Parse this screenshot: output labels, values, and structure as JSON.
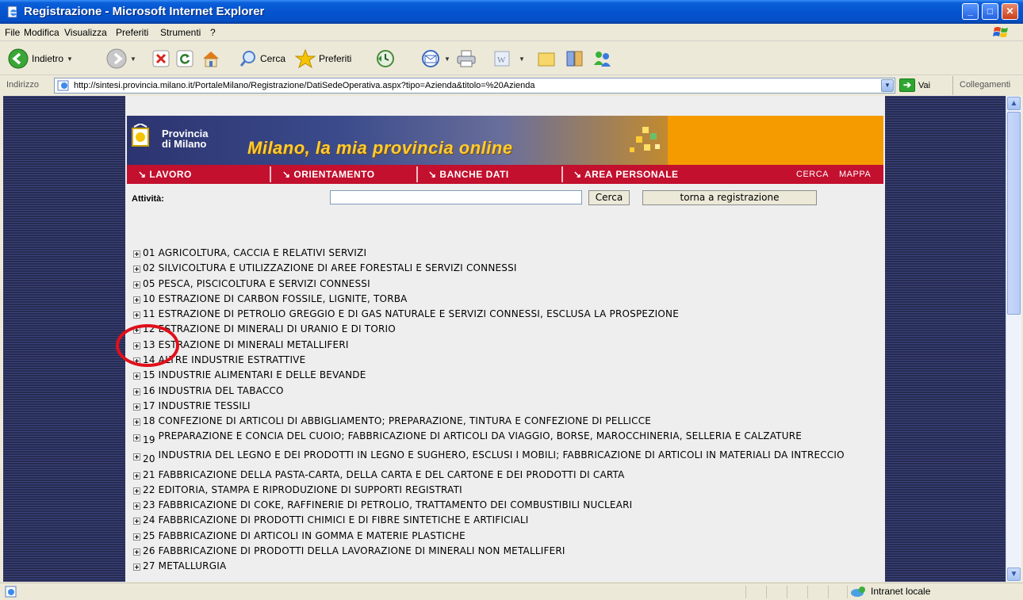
{
  "window": {
    "title": "Registrazione - Microsoft Internet Explorer",
    "controls": {
      "minimize": "_",
      "maximize": "□",
      "close": "✕"
    }
  },
  "menu": [
    "File",
    "Modifica",
    "Visualizza",
    "Preferiti",
    "Strumenti",
    "?"
  ],
  "toolbar": {
    "back_label": "Indietro",
    "search_label": "Cerca",
    "favorites_label": "Preferiti"
  },
  "address": {
    "label": "Indirizzo",
    "url": "http://sintesi.provincia.milano.it/PortaleMilano/Registrazione/DatiSedeOperativa.aspx?tipo=Azienda&titolo=%20Azienda",
    "go_label": "Vai",
    "links_label": "Collegamenti"
  },
  "banner": {
    "org_line1": "Provincia",
    "org_line2": "di Milano",
    "tagline": "Milano, la mia provincia online"
  },
  "nav": {
    "items": [
      "LAVORO",
      "ORIENTAMENTO",
      "BANCHE DATI",
      "AREA PERSONALE"
    ],
    "arrow": "↘",
    "cerca": "CERCA",
    "mappa": "MAPPA"
  },
  "search": {
    "label": "Attività:",
    "value": "",
    "search_button": "Cerca",
    "back_button": "torna a registrazione"
  },
  "activities": [
    {
      "code": "01",
      "text": "AGRICOLTURA, CACCIA E RELATIVI SERVIZI"
    },
    {
      "code": "02",
      "text": "SILVICOLTURA E UTILIZZAZIONE DI AREE FORESTALI E SERVIZI CONNESSI"
    },
    {
      "code": "05",
      "text": "PESCA, PISCICOLTURA E SERVIZI CONNESSI"
    },
    {
      "code": "10",
      "text": "ESTRAZIONE DI CARBON FOSSILE, LIGNITE, TORBA"
    },
    {
      "code": "11",
      "text": "ESTRAZIONE DI PETROLIO GREGGIO E DI GAS NATURALE E SERVIZI CONNESSI, ESCLUSA LA PROSPEZIONE"
    },
    {
      "code": "12",
      "text": "ESTRAZIONE DI MINERALI DI URANIO E DI TORIO"
    },
    {
      "code": "13",
      "text": "ESTRAZIONE DI MINERALI METALLIFERI"
    },
    {
      "code": "14",
      "text": "ALTRE INDUSTRIE ESTRATTIVE"
    },
    {
      "code": "15",
      "text": "INDUSTRIE ALIMENTARI E DELLE BEVANDE"
    },
    {
      "code": "16",
      "text": "INDUSTRIA DEL TABACCO"
    },
    {
      "code": "17",
      "text": "INDUSTRIE TESSILI"
    },
    {
      "code": "18",
      "text": "CONFEZIONE DI ARTICOLI DI ABBIGLIAMENTO; PREPARAZIONE, TINTURA E CONFEZIONE DI PELLICCE"
    },
    {
      "code": "19",
      "text": "PREPARAZIONE E CONCIA DEL CUOIO; FABBRICAZIONE DI ARTICOLI DA VIAGGIO, BORSE, MAROCCHINERIA, SELLERIA E CALZATURE"
    },
    {
      "code": "20",
      "text": "INDUSTRIA DEL LEGNO E DEI PRODOTTI IN LEGNO E SUGHERO, ESCLUSI I MOBILI; FABBRICAZIONE DI ARTICOLI IN MATERIALI DA INTRECCIO"
    },
    {
      "code": "21",
      "text": "FABBRICAZIONE DELLA PASTA-CARTA, DELLA CARTA E DEL CARTONE E DEI PRODOTTI DI CARTA"
    },
    {
      "code": "22",
      "text": "EDITORIA, STAMPA E RIPRODUZIONE DI SUPPORTI REGISTRATI"
    },
    {
      "code": "23",
      "text": "FABBRICAZIONE DI COKE, RAFFINERIE DI PETROLIO, TRATTAMENTO DEI COMBUSTIBILI NUCLEARI"
    },
    {
      "code": "24",
      "text": "FABBRICAZIONE DI PRODOTTI CHIMICI E DI FIBRE SINTETICHE E ARTIFICIALI"
    },
    {
      "code": "25",
      "text": "FABBRICAZIONE DI ARTICOLI IN GOMMA E MATERIE PLASTICHE"
    },
    {
      "code": "26",
      "text": "FABBRICAZIONE DI PRODOTTI DELLA LAVORAZIONE DI MINERALI NON METALLIFERI"
    },
    {
      "code": "27",
      "text": "METALLURGIA"
    }
  ],
  "status": {
    "zone": "Intranet locale"
  },
  "colors": {
    "nav_red": "#c2102e",
    "banner_orange": "#f59b00",
    "highlight_red": "#e0101a",
    "titlebar_blue": "#0553cf"
  }
}
